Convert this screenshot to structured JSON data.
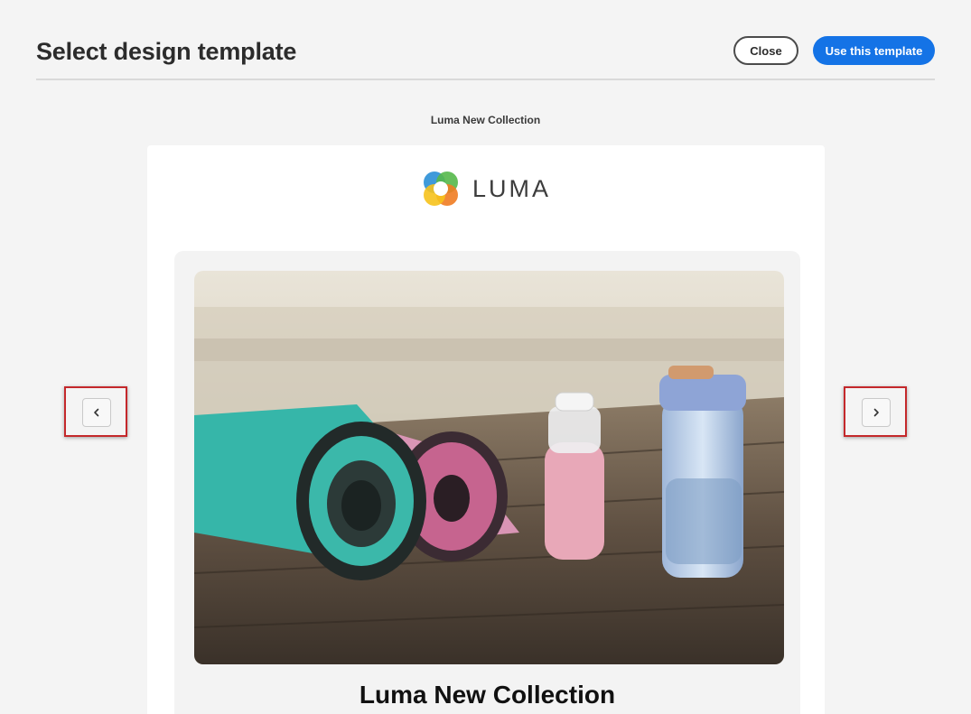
{
  "header": {
    "title": "Select design template",
    "close_label": "Close",
    "use_label": "Use this template",
    "accent_color": "#1473e6"
  },
  "template": {
    "name": "Luma New Collection"
  },
  "preview": {
    "logo_text": "LUMA",
    "hero_image": "yoga-mats-and-water-bottles-photo",
    "card_title": "Luma New Collection"
  },
  "navigation": {
    "prev_icon": "chevron-left-icon",
    "next_icon": "chevron-right-icon",
    "highlight_color": "#c4282b"
  }
}
